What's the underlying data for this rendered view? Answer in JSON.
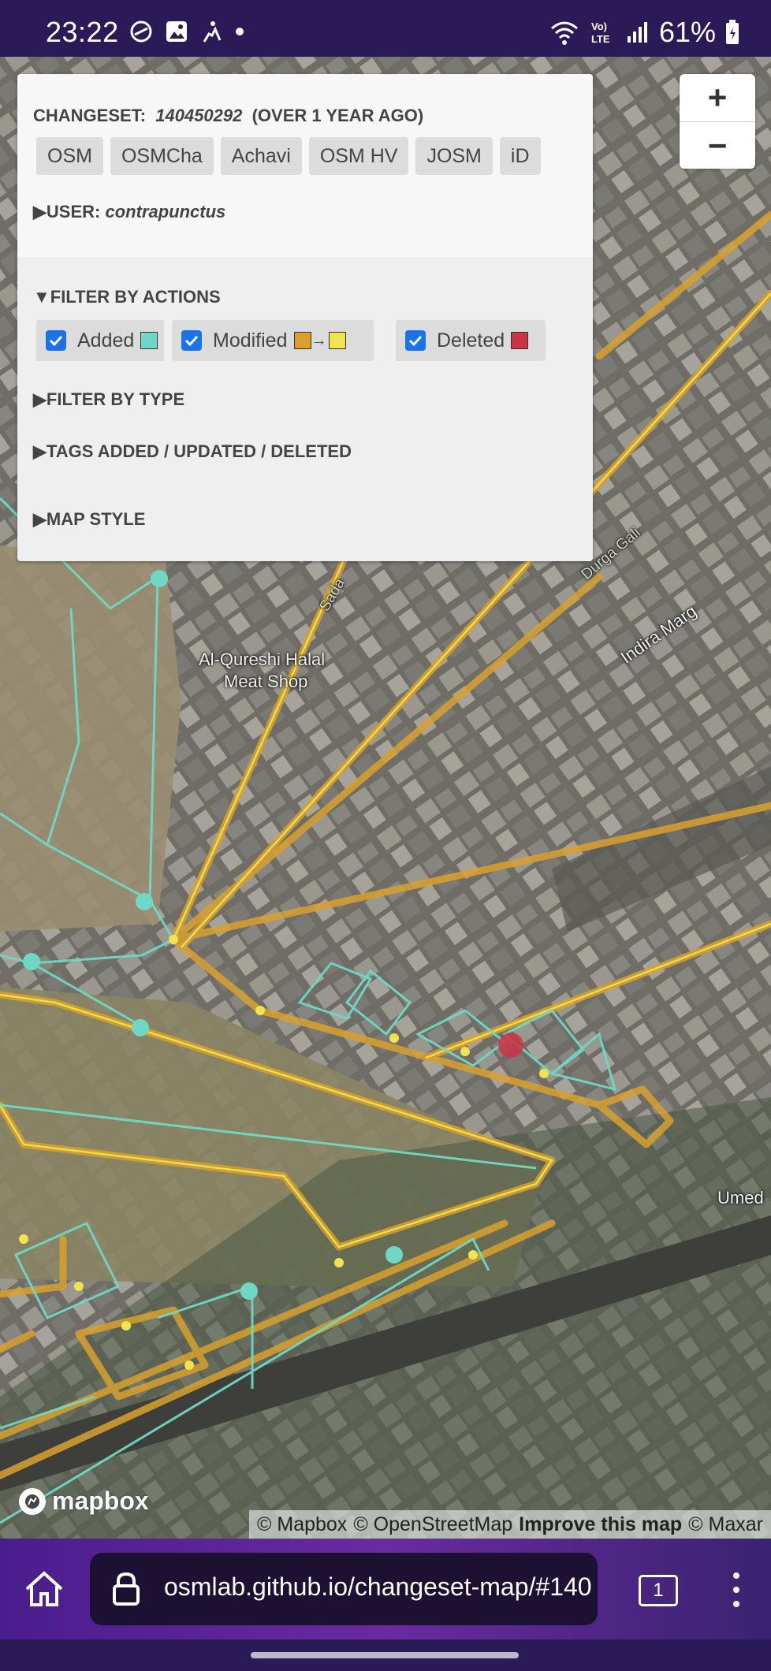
{
  "status_bar": {
    "time": "23:22",
    "battery": "61%",
    "icons": [
      "vpn-icon",
      "gallery-icon",
      "activity-icon",
      "dot-icon",
      "wifi-icon",
      "volte-icon",
      "signal-icon",
      "battery-icon"
    ],
    "volte_label": "Vo) LTE"
  },
  "panel": {
    "changeset_label": "CHANGESET:",
    "changeset_id": "140450292",
    "changeset_age": "(OVER 1 YEAR AGO)",
    "buttons": [
      "OSM",
      "OSMCha",
      "Achavi",
      "OSM HV",
      "JOSM",
      "iD"
    ],
    "user_label": "▶USER:",
    "user_name": "contrapunctus",
    "filter_actions": "▼FILTER BY ACTIONS",
    "filters": {
      "added": {
        "label": "Added",
        "color": "#6ed8c5",
        "checked": true
      },
      "modified": {
        "label": "Modified",
        "from_color": "#d8a12e",
        "arrow": "→",
        "to_color": "#f1e44f",
        "checked": true
      },
      "deleted": {
        "label": "Deleted",
        "color": "#cc3344",
        "checked": true
      }
    },
    "filter_type": "▶FILTER BY TYPE",
    "tags": "▶TAGS ADDED / UPDATED / DELETED",
    "map_style": "▶MAP STYLE"
  },
  "zoom": {
    "in": "+",
    "out": "−"
  },
  "map_labels": {
    "shop_line1": "Al-Qureshi Halal",
    "shop_line2": "Meat Shop",
    "indira": "Indira Marg",
    "durga": "Durga Gali",
    "umed": "Umed",
    "road_frag": "Sada"
  },
  "attribution": {
    "logo": "mapbox",
    "mapbox": "© Mapbox",
    "osm": "© OpenStreetMap",
    "improve": "Improve this map",
    "maxar": "© Maxar"
  },
  "browser": {
    "url": "osmlab.github.io/changeset-map/#140",
    "tab_count": "1"
  },
  "colors": {
    "added": "#6ed8c5",
    "modified_old": "#d8a12e",
    "modified_new": "#f1e44f",
    "deleted": "#cc3344",
    "accent": "#1a73e8"
  }
}
